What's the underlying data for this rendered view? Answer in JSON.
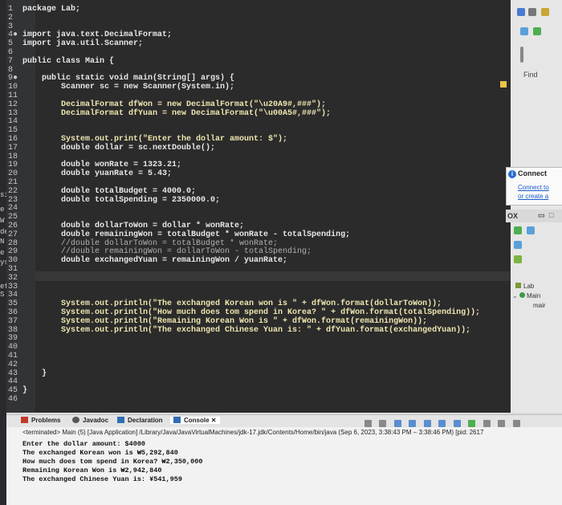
{
  "left_strip": [
    "si",
    "e",
    "W",
    "de",
    "N",
    "e",
    "ys",
    "efi",
    "S"
  ],
  "editor": {
    "lines": [
      {
        "n": "1",
        "code": "package Lab;"
      },
      {
        "n": "2",
        "code": ""
      },
      {
        "n": "3",
        "code": ""
      },
      {
        "n": "4●",
        "code": "import java.text.DecimalFormat;"
      },
      {
        "n": "5",
        "code": "import java.util.Scanner;"
      },
      {
        "n": "6",
        "code": ""
      },
      {
        "n": "7",
        "code": "public class Main {"
      },
      {
        "n": "8",
        "code": ""
      },
      {
        "n": "9●",
        "code": "    public static void main(String[] args) {"
      },
      {
        "n": "10",
        "code": "        Scanner sc = new Scanner(System.in);"
      },
      {
        "n": "11",
        "code": ""
      },
      {
        "n": "12",
        "code": "        DecimalFormat dfWon = new DecimalFormat(\"\\u20A9#,###\");"
      },
      {
        "n": "13",
        "code": "        DecimalFormat dfYuan = new DecimalFormat(\"\\u00A5#,###\");"
      },
      {
        "n": "14",
        "code": ""
      },
      {
        "n": "15",
        "code": ""
      },
      {
        "n": "16",
        "code": "        System.out.print(\"Enter the dollar amount: $\");"
      },
      {
        "n": "17",
        "code": "        double dollar = sc.nextDouble();"
      },
      {
        "n": "18",
        "code": ""
      },
      {
        "n": "19",
        "code": "        double wonRate = 1323.21;"
      },
      {
        "n": "20",
        "code": "        double yuanRate = 5.43;"
      },
      {
        "n": "21",
        "code": ""
      },
      {
        "n": "22",
        "code": "        double totalBudget = 4000.0;"
      },
      {
        "n": "23",
        "code": "        double totalSpending = 2350000.0;"
      },
      {
        "n": "24",
        "code": ""
      },
      {
        "n": "25",
        "code": ""
      },
      {
        "n": "26",
        "code": "        double dollarToWon = dollar * wonRate;"
      },
      {
        "n": "27",
        "code": "        double remainingWon = totalBudget * wonRate - totalSpending;"
      },
      {
        "n": "28",
        "code": "        //double dollarToWon = totalBudget * wonRate;"
      },
      {
        "n": "29",
        "code": "        //double remainingWon = dollarToWon - totalSpending;"
      },
      {
        "n": "30",
        "code": "        double exchangedYuan = remainingWon / yuanRate;"
      },
      {
        "n": "31",
        "code": ""
      },
      {
        "n": "32",
        "code": ""
      },
      {
        "n": "33",
        "code": ""
      },
      {
        "n": "34",
        "code": ""
      },
      {
        "n": "35",
        "code": "        System.out.println(\"The exchanged Korean won is \" + dfWon.format(dollarToWon));"
      },
      {
        "n": "36",
        "code": "        System.out.println(\"How much does tom spend in Korea? \" + dfWon.format(totalSpending));"
      },
      {
        "n": "37",
        "code": "        System.out.println(\"Remaining Korean Won is \" + dfWon.format(remainingWon));"
      },
      {
        "n": "38",
        "code": "        System.out.println(\"The exchanged Chinese Yuan is: \" + dfYuan.format(exchangedYuan));"
      },
      {
        "n": "39",
        "code": ""
      },
      {
        "n": "40",
        "code": ""
      },
      {
        "n": "41",
        "code": ""
      },
      {
        "n": "42",
        "code": ""
      },
      {
        "n": "43",
        "code": "    }"
      },
      {
        "n": "44",
        "code": ""
      },
      {
        "n": "45",
        "code": "}"
      },
      {
        "n": "46",
        "code": ""
      }
    ]
  },
  "right_panel": {
    "find_label": "Find",
    "connect_title": "Connect",
    "connect_link1": "Connect to",
    "connect_link2": "or create a",
    "outline_label": "OX",
    "tree_lab": "Lab",
    "tree_main": "Main",
    "tree_main_method": "mair"
  },
  "console": {
    "tabs": [
      {
        "label": "Problems",
        "icon": "problems-icon",
        "color": "#c0392b"
      },
      {
        "label": "Javadoc",
        "icon": "javadoc-icon",
        "color": "#555555"
      },
      {
        "label": "Declaration",
        "icon": "declaration-icon",
        "color": "#2f6db5"
      },
      {
        "label": "Console",
        "icon": "console-icon",
        "color": "#2f6db5",
        "active": true
      }
    ],
    "terminated": "<terminated> Main (5) [Java Application] /Library/Java/JavaVirtualMachines/jdk-17.jdk/Contents/Home/bin/java (Sep 6, 2023, 3:38:43 PM – 3:38:46 PM) [pid: 2617",
    "output": [
      "Enter the dollar amount: $4000",
      "The exchanged Korean won is ₩5,292,840",
      "How much does tom spend in Korea? ₩2,350,000",
      "Remaining Korean Won is ₩2,942,840",
      "The exchanged Chinese Yuan is: ¥541,959"
    ]
  }
}
